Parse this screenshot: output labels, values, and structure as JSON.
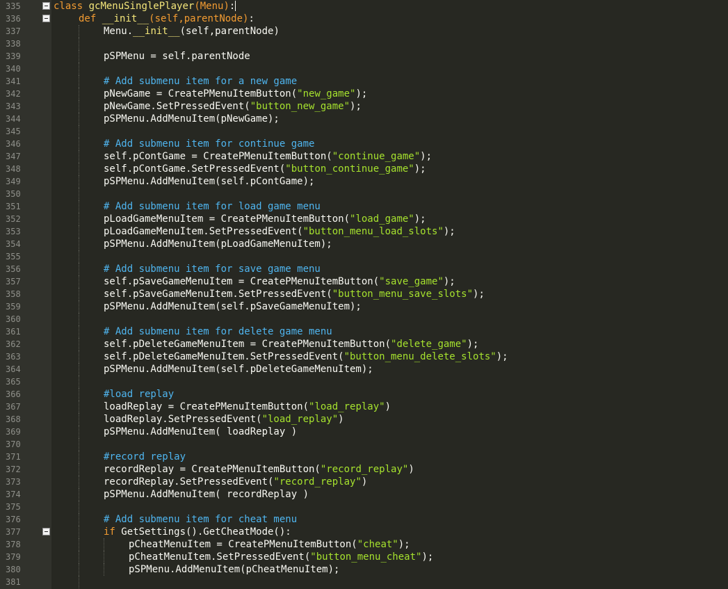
{
  "lines": [
    {
      "n": "335",
      "fold": true,
      "indent": 0,
      "tokens": [
        [
          "kw",
          "class"
        ],
        [
          "t",
          " "
        ],
        [
          "cls",
          "gcMenuSinglePlayer"
        ],
        [
          "arg",
          "(Menu)"
        ],
        [
          "t",
          ":"
        ]
      ],
      "cursor": true
    },
    {
      "n": "336",
      "fold": true,
      "indent": 1,
      "tokens": [
        [
          "kw",
          "def"
        ],
        [
          "t",
          " "
        ],
        [
          "dunder",
          "__init__"
        ],
        [
          "arg",
          "(self,parentNode)"
        ],
        [
          "t",
          ":"
        ]
      ]
    },
    {
      "n": "337",
      "indent": 2,
      "tokens": [
        [
          "t",
          "Menu."
        ],
        [
          "dunder",
          "__init__"
        ],
        [
          "t",
          "(self,parentNode)"
        ]
      ]
    },
    {
      "n": "338",
      "indent": 2,
      "tokens": []
    },
    {
      "n": "339",
      "indent": 2,
      "tokens": [
        [
          "t",
          "pSPMenu = self.parentNode"
        ]
      ]
    },
    {
      "n": "340",
      "indent": 2,
      "tokens": []
    },
    {
      "n": "341",
      "indent": 2,
      "tokens": [
        [
          "cmt",
          "# Add submenu item for a new game"
        ]
      ]
    },
    {
      "n": "342",
      "indent": 2,
      "tokens": [
        [
          "t",
          "pNewGame = CreatePMenuItemButton("
        ],
        [
          "str",
          "\"new_game\""
        ],
        [
          "t",
          ");"
        ]
      ]
    },
    {
      "n": "343",
      "indent": 2,
      "tokens": [
        [
          "t",
          "pNewGame.SetPressedEvent("
        ],
        [
          "str",
          "\"button_new_game\""
        ],
        [
          "t",
          ");"
        ]
      ]
    },
    {
      "n": "344",
      "indent": 2,
      "tokens": [
        [
          "t",
          "pSPMenu.AddMenuItem(pNewGame);"
        ]
      ]
    },
    {
      "n": "345",
      "indent": 2,
      "tokens": []
    },
    {
      "n": "346",
      "indent": 2,
      "tokens": [
        [
          "cmt",
          "# Add submenu item for continue game"
        ]
      ]
    },
    {
      "n": "347",
      "indent": 2,
      "tokens": [
        [
          "t",
          "self.pContGame = CreatePMenuItemButton("
        ],
        [
          "str",
          "\"continue_game\""
        ],
        [
          "t",
          ");"
        ]
      ]
    },
    {
      "n": "348",
      "indent": 2,
      "tokens": [
        [
          "t",
          "self.pContGame.SetPressedEvent("
        ],
        [
          "str",
          "\"button_continue_game\""
        ],
        [
          "t",
          ");"
        ]
      ]
    },
    {
      "n": "349",
      "indent": 2,
      "tokens": [
        [
          "t",
          "pSPMenu.AddMenuItem(self.pContGame);"
        ]
      ]
    },
    {
      "n": "350",
      "indent": 2,
      "tokens": []
    },
    {
      "n": "351",
      "indent": 2,
      "tokens": [
        [
          "cmt",
          "# Add submenu item for load game menu"
        ]
      ]
    },
    {
      "n": "352",
      "indent": 2,
      "tokens": [
        [
          "t",
          "pLoadGameMenuItem = CreatePMenuItemButton("
        ],
        [
          "str",
          "\"load_game\""
        ],
        [
          "t",
          ");"
        ]
      ]
    },
    {
      "n": "353",
      "indent": 2,
      "tokens": [
        [
          "t",
          "pLoadGameMenuItem.SetPressedEvent("
        ],
        [
          "str",
          "\"button_menu_load_slots\""
        ],
        [
          "t",
          ");"
        ]
      ]
    },
    {
      "n": "354",
      "indent": 2,
      "tokens": [
        [
          "t",
          "pSPMenu.AddMenuItem(pLoadGameMenuItem);"
        ]
      ]
    },
    {
      "n": "355",
      "indent": 2,
      "tokens": []
    },
    {
      "n": "356",
      "indent": 2,
      "tokens": [
        [
          "cmt",
          "# Add submenu item for save game menu"
        ]
      ]
    },
    {
      "n": "357",
      "indent": 2,
      "tokens": [
        [
          "t",
          "self.pSaveGameMenuItem = CreatePMenuItemButton("
        ],
        [
          "str",
          "\"save_game\""
        ],
        [
          "t",
          ");"
        ]
      ]
    },
    {
      "n": "358",
      "indent": 2,
      "tokens": [
        [
          "t",
          "self.pSaveGameMenuItem.SetPressedEvent("
        ],
        [
          "str",
          "\"button_menu_save_slots\""
        ],
        [
          "t",
          ");"
        ]
      ]
    },
    {
      "n": "359",
      "indent": 2,
      "tokens": [
        [
          "t",
          "pSPMenu.AddMenuItem(self.pSaveGameMenuItem);"
        ]
      ]
    },
    {
      "n": "360",
      "indent": 2,
      "tokens": []
    },
    {
      "n": "361",
      "indent": 2,
      "tokens": [
        [
          "cmt",
          "# Add submenu item for delete game menu"
        ]
      ]
    },
    {
      "n": "362",
      "indent": 2,
      "tokens": [
        [
          "t",
          "self.pDeleteGameMenuItem = CreatePMenuItemButton("
        ],
        [
          "str",
          "\"delete_game\""
        ],
        [
          "t",
          ");"
        ]
      ]
    },
    {
      "n": "363",
      "indent": 2,
      "tokens": [
        [
          "t",
          "self.pDeleteGameMenuItem.SetPressedEvent("
        ],
        [
          "str",
          "\"button_menu_delete_slots\""
        ],
        [
          "t",
          ");"
        ]
      ]
    },
    {
      "n": "364",
      "indent": 2,
      "tokens": [
        [
          "t",
          "pSPMenu.AddMenuItem(self.pDeleteGameMenuItem);"
        ]
      ]
    },
    {
      "n": "365",
      "indent": 2,
      "tokens": []
    },
    {
      "n": "366",
      "indent": 2,
      "tokens": [
        [
          "cmt",
          "#load replay"
        ]
      ]
    },
    {
      "n": "367",
      "indent": 2,
      "tokens": [
        [
          "t",
          "loadReplay = CreatePMenuItemButton("
        ],
        [
          "str",
          "\"load_replay\""
        ],
        [
          "t",
          ")"
        ]
      ]
    },
    {
      "n": "368",
      "indent": 2,
      "tokens": [
        [
          "t",
          "loadReplay.SetPressedEvent("
        ],
        [
          "str",
          "\"load_replay\""
        ],
        [
          "t",
          ")"
        ]
      ]
    },
    {
      "n": "369",
      "indent": 2,
      "tokens": [
        [
          "t",
          "pSPMenu.AddMenuItem( loadReplay )"
        ]
      ]
    },
    {
      "n": "370",
      "indent": 2,
      "tokens": []
    },
    {
      "n": "371",
      "indent": 2,
      "tokens": [
        [
          "cmt",
          "#record replay"
        ]
      ]
    },
    {
      "n": "372",
      "indent": 2,
      "tokens": [
        [
          "t",
          "recordReplay = CreatePMenuItemButton("
        ],
        [
          "str",
          "\"record_replay\""
        ],
        [
          "t",
          ")"
        ]
      ]
    },
    {
      "n": "373",
      "indent": 2,
      "tokens": [
        [
          "t",
          "recordReplay.SetPressedEvent("
        ],
        [
          "str",
          "\"record_replay\""
        ],
        [
          "t",
          ")"
        ]
      ]
    },
    {
      "n": "374",
      "indent": 2,
      "tokens": [
        [
          "t",
          "pSPMenu.AddMenuItem( recordReplay )"
        ]
      ]
    },
    {
      "n": "375",
      "indent": 2,
      "tokens": []
    },
    {
      "n": "376",
      "indent": 2,
      "tokens": [
        [
          "cmt",
          "# Add submenu item for cheat menu"
        ]
      ]
    },
    {
      "n": "377",
      "fold": true,
      "indent": 2,
      "tokens": [
        [
          "kw",
          "if"
        ],
        [
          "t",
          " GetSettings().GetCheatMode():"
        ]
      ]
    },
    {
      "n": "378",
      "indent": 3,
      "tokens": [
        [
          "t",
          "pCheatMenuItem = CreatePMenuItemButton("
        ],
        [
          "str",
          "\"cheat\""
        ],
        [
          "t",
          ");"
        ]
      ]
    },
    {
      "n": "379",
      "indent": 3,
      "tokens": [
        [
          "t",
          "pCheatMenuItem.SetPressedEvent("
        ],
        [
          "str",
          "\"button_menu_cheat\""
        ],
        [
          "t",
          ");"
        ]
      ]
    },
    {
      "n": "380",
      "indent": 3,
      "tokens": [
        [
          "t",
          "pSPMenu.AddMenuItem(pCheatMenuItem);"
        ]
      ]
    },
    {
      "n": "381",
      "indent": 2,
      "tokens": []
    }
  ]
}
